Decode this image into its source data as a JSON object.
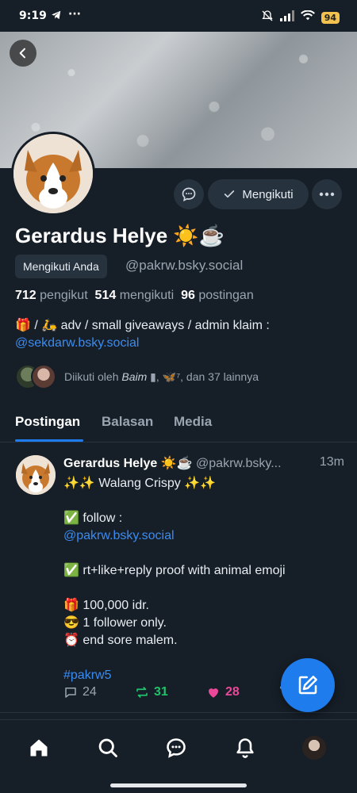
{
  "status_bar": {
    "time": "9:19",
    "battery": "94",
    "icons": [
      "telegram-icon",
      "more-dots-icon",
      "mute-icon",
      "signal-icon",
      "wifi-icon",
      "battery-icon"
    ]
  },
  "profile": {
    "name": "Gerardus Helye ☀️☕",
    "follows_you": "Mengikuti Anda",
    "handle": "@pakrw.bsky.social",
    "follow_button": "Mengikuti",
    "stats": {
      "followers_count": "712",
      "followers_label": "pengikut",
      "following_count": "514",
      "following_label": "mengikuti",
      "posts_count": "96",
      "posts_label": "postingan"
    },
    "bio_line1": "🎁 / 🛵 adv / small giveaways / admin klaim :",
    "bio_link": "@sekdarw.bsky.social",
    "followed_by_prefix": "Diikuti oleh ",
    "followed_by_name": "Baim",
    "followed_by_suffix": " ▮, 🦋⁷, dan 37 lainnya"
  },
  "tabs": [
    {
      "label": "Postingan",
      "active": true
    },
    {
      "label": "Balasan",
      "active": false
    },
    {
      "label": "Media",
      "active": false
    }
  ],
  "post": {
    "author": "Gerardus Helye ☀️☕",
    "handle": "@pakrw.bsky...",
    "time": "13m",
    "lines": [
      "✨✨ Walang Crispy ✨✨",
      "",
      "✅ follow :",
      "@pakrw.bsky.social",
      "",
      "✅ rt+like+reply proof with animal emoji",
      "",
      "🎁 100,000 idr.",
      "😎 1 follower only.",
      "⏰  end sore malem.",
      "",
      "#pakrw5"
    ],
    "reply_count": "24",
    "repost_count": "31",
    "like_count": "28"
  },
  "colors": {
    "background": "#161e27",
    "accent": "#1f7cec",
    "link": "#3b8cf0",
    "repost": "#21c26b",
    "like": "#ec4899",
    "muted": "#9aa5b1"
  }
}
